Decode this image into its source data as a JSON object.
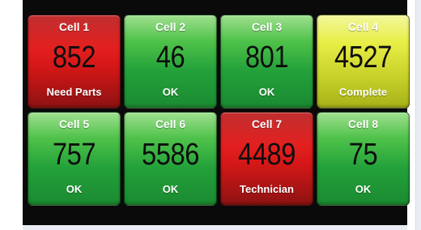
{
  "cells": [
    {
      "title": "Cell 1",
      "value": "852",
      "status": "Need Parts",
      "state": "alert"
    },
    {
      "title": "Cell 2",
      "value": "46",
      "status": "OK",
      "state": "ok"
    },
    {
      "title": "Cell 3",
      "value": "801",
      "status": "OK",
      "state": "ok"
    },
    {
      "title": "Cell 4",
      "value": "4527",
      "status": "Complete",
      "state": "done"
    },
    {
      "title": "Cell 5",
      "value": "757",
      "status": "OK",
      "state": "ok"
    },
    {
      "title": "Cell 6",
      "value": "5586",
      "status": "OK",
      "state": "ok"
    },
    {
      "title": "Cell 7",
      "value": "4489",
      "status": "Technician",
      "state": "alert"
    },
    {
      "title": "Cell 8",
      "value": "75",
      "status": "OK",
      "state": "ok"
    }
  ],
  "colors": {
    "ok": "#23a13a",
    "alert": "#e32020",
    "done": "#e7ee45",
    "background": "#0a0a0a"
  }
}
